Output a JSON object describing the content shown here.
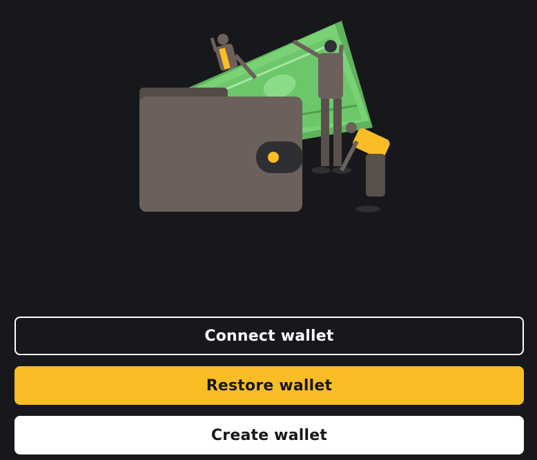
{
  "colors": {
    "background": "#17181b",
    "accent": "#fbbd25",
    "wallet": "#6c605a",
    "money": "#6cc76a",
    "button_text_dark": "#17181b",
    "button_text_light": "#ffffff"
  },
  "illustration": {
    "icon": "wallet-with-money-illustration"
  },
  "actions": {
    "connect_label": "Connect wallet",
    "restore_label": "Restore wallet",
    "create_label": "Create wallet"
  }
}
